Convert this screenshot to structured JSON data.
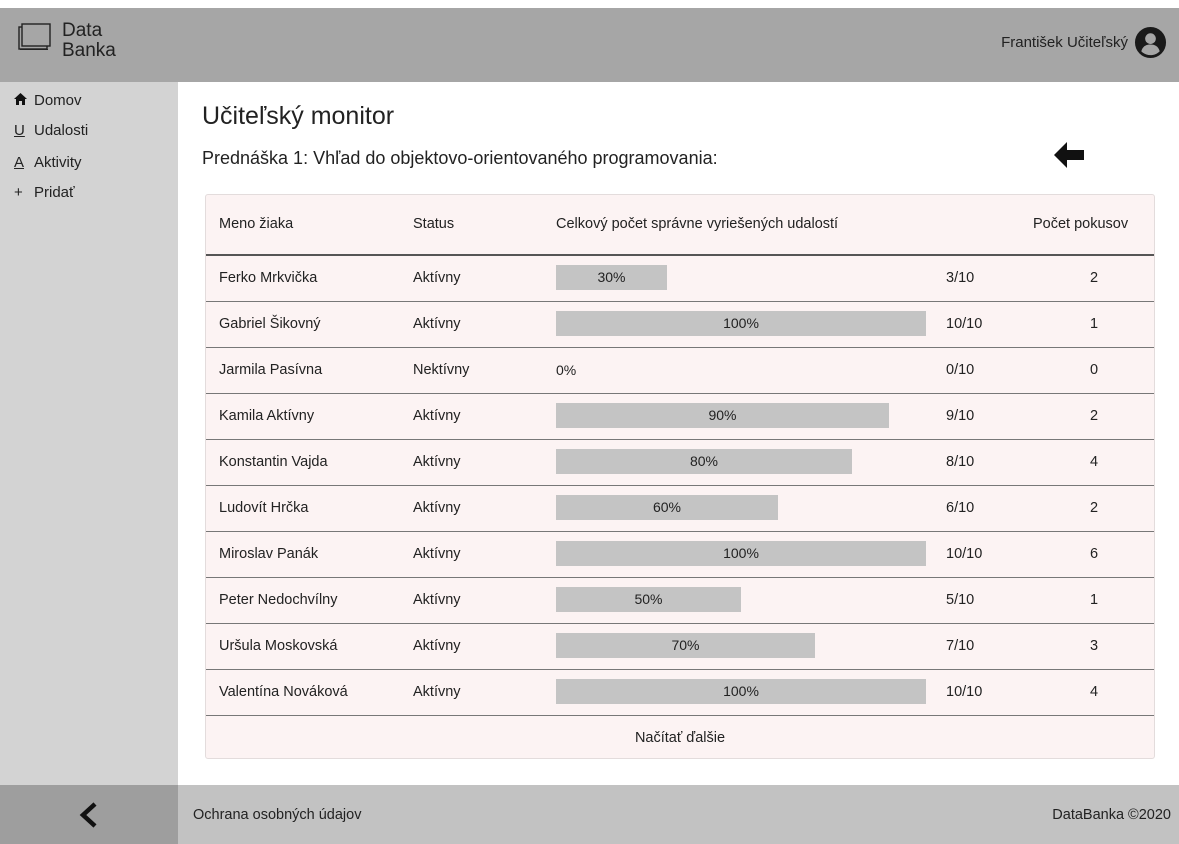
{
  "app": {
    "logo_line1": "Data",
    "logo_line2": "Banka",
    "user_name": "František Učiteľský"
  },
  "sidebar": {
    "items": [
      {
        "icon": "home-icon",
        "glyph": "",
        "label": "Domov"
      },
      {
        "icon": "u-letter-icon",
        "glyph": "U",
        "label": "Udalosti"
      },
      {
        "icon": "a-letter-icon",
        "glyph": "A",
        "label": "Aktivity"
      },
      {
        "icon": "plus-icon",
        "glyph": "+",
        "label": "Pridať"
      }
    ]
  },
  "main": {
    "title": "Učiteľský monitor",
    "subtitle": "Prednáška 1: Vhľad do objektovo-orientovaného programovania:"
  },
  "table": {
    "headers": {
      "name": "Meno žiaka",
      "status": "Status",
      "correct": "Celkový počet správne vyriešených udalostí",
      "attempts": "Počet pokusov"
    },
    "rows": [
      {
        "name": "Ferko Mrkvička",
        "status": "Aktívny",
        "percent": 30,
        "percent_label": "30%",
        "ratio": "3/10",
        "attempts": "2"
      },
      {
        "name": "Gabriel Šikovný",
        "status": "Aktívny",
        "percent": 100,
        "percent_label": "100%",
        "ratio": "10/10",
        "attempts": "1"
      },
      {
        "name": "Jarmila Pasívna",
        "status": "Nektívny",
        "percent": 0,
        "percent_label": "0%",
        "ratio": "0/10",
        "attempts": "0"
      },
      {
        "name": "Kamila Aktívny",
        "status": "Aktívny",
        "percent": 90,
        "percent_label": "90%",
        "ratio": "9/10",
        "attempts": "2"
      },
      {
        "name": "Konstantin Vajda",
        "status": "Aktívny",
        "percent": 80,
        "percent_label": "80%",
        "ratio": "8/10",
        "attempts": "4"
      },
      {
        "name": "Ludovít Hrčka",
        "status": "Aktívny",
        "percent": 60,
        "percent_label": "60%",
        "ratio": "6/10",
        "attempts": "2"
      },
      {
        "name": "Miroslav Panák",
        "status": "Aktívny",
        "percent": 100,
        "percent_label": "100%",
        "ratio": "10/10",
        "attempts": "6"
      },
      {
        "name": "Peter Nedochvílny",
        "status": "Aktívny",
        "percent": 50,
        "percent_label": "50%",
        "ratio": "5/10",
        "attempts": "1"
      },
      {
        "name": " Uršula Moskovská",
        "status": "Aktívny",
        "percent": 70,
        "percent_label": "70%",
        "ratio": "7/10",
        "attempts": "3"
      },
      {
        "name": "Valentína Nováková",
        "status": "Aktívny",
        "percent": 100,
        "percent_label": "100%",
        "ratio": "10/10",
        "attempts": "4"
      }
    ],
    "load_more": "Načítať ďalšie"
  },
  "footer": {
    "privacy": "Ochrana osobných údajov",
    "copyright": "DataBanka ©2020"
  },
  "colors": {
    "header_bg": "#a6a6a6",
    "sidebar_bg": "#d3d3d3",
    "card_bg": "#fcf3f3",
    "bar_fill": "#c4c4c4",
    "footer_bg": "#c2c2c2"
  }
}
